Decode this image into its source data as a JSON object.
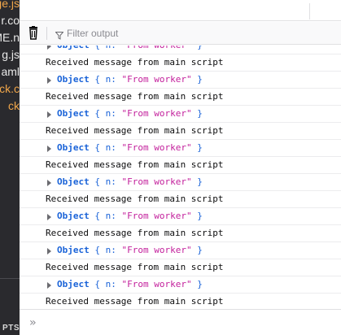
{
  "sidebar": {
    "files": [
      {
        "text": "ge.js",
        "tone": "orange"
      },
      {
        "text": "r.co",
        "tone": "white"
      },
      {
        "text": "ME.n",
        "tone": "white"
      },
      {
        "text": "g.js",
        "tone": "white"
      },
      {
        "text": "aml",
        "tone": "white"
      },
      {
        "text": "ck.c",
        "tone": "orange"
      },
      {
        "text": "ck",
        "tone": "orange"
      }
    ],
    "bottom_label": "PTS"
  },
  "toolbar": {
    "filter_placeholder": "Filter output"
  },
  "console": {
    "rows": [
      {
        "type": "object",
        "keyword": "Object",
        "key": "n",
        "value": "\"From worker\""
      },
      {
        "type": "text",
        "text": "Received message from main script"
      },
      {
        "type": "object",
        "keyword": "Object",
        "key": "n",
        "value": "\"From worker\""
      },
      {
        "type": "text",
        "text": "Received message from main script"
      },
      {
        "type": "object",
        "keyword": "Object",
        "key": "n",
        "value": "\"From worker\""
      },
      {
        "type": "text",
        "text": "Received message from main script"
      },
      {
        "type": "object",
        "keyword": "Object",
        "key": "n",
        "value": "\"From worker\""
      },
      {
        "type": "text",
        "text": "Received message from main script"
      },
      {
        "type": "object",
        "keyword": "Object",
        "key": "n",
        "value": "\"From worker\""
      },
      {
        "type": "text",
        "text": "Received message from main script"
      },
      {
        "type": "object",
        "keyword": "Object",
        "key": "n",
        "value": "\"From worker\""
      },
      {
        "type": "text",
        "text": "Received message from main script"
      },
      {
        "type": "object",
        "keyword": "Object",
        "key": "n",
        "value": "\"From worker\""
      },
      {
        "type": "text",
        "text": "Received message from main script"
      },
      {
        "type": "object",
        "keyword": "Object",
        "key": "n",
        "value": "\"From worker\""
      },
      {
        "type": "text",
        "text": "Received message from main script"
      }
    ],
    "prompt_symbol": "»"
  },
  "colors": {
    "keyword": "#1a63d8",
    "string": "#c3209c",
    "sidebar_bg": "#2a2a2e",
    "sidebar_orange": "#f0a64a"
  },
  "icons": {
    "trash": "trash-icon",
    "filter": "filter-icon",
    "expand": "expand-arrow-icon",
    "prompt": "prompt-chevrons-icon"
  }
}
